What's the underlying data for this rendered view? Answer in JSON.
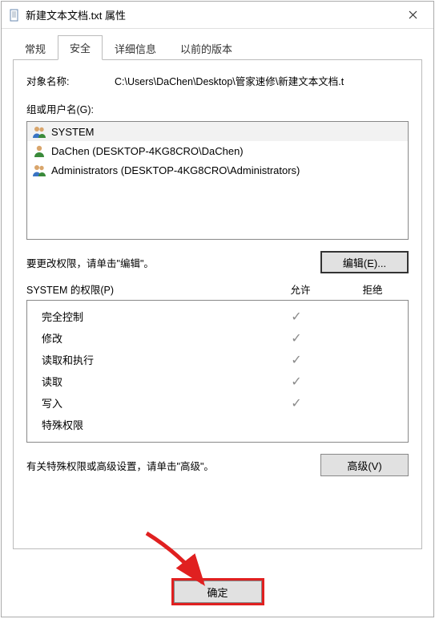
{
  "window": {
    "title": "新建文本文档.txt 属性"
  },
  "tabs": {
    "general": "常规",
    "security": "安全",
    "details": "详细信息",
    "previous": "以前的版本",
    "active": "security"
  },
  "security": {
    "objectLabel": "对象名称:",
    "objectPath": "C:\\Users\\DaChen\\Desktop\\管家速修\\新建文本文档.t",
    "groupLabel": "组或用户名(G):",
    "users": [
      {
        "name": "SYSTEM",
        "iconType": "group",
        "selected": true
      },
      {
        "name": "DaChen (DESKTOP-4KG8CRO\\DaChen)",
        "iconType": "user",
        "selected": false
      },
      {
        "name": "Administrators (DESKTOP-4KG8CRO\\Administrators)",
        "iconType": "group",
        "selected": false
      }
    ],
    "editHint": "要更改权限，请单击\"编辑\"。",
    "editButton": "编辑(E)...",
    "permHeaderFor": "SYSTEM 的权限(P)",
    "colAllow": "允许",
    "colDeny": "拒绝",
    "permissions": [
      {
        "name": "完全控制",
        "allow": true,
        "deny": false
      },
      {
        "name": "修改",
        "allow": true,
        "deny": false
      },
      {
        "name": "读取和执行",
        "allow": true,
        "deny": false
      },
      {
        "name": "读取",
        "allow": true,
        "deny": false
      },
      {
        "name": "写入",
        "allow": true,
        "deny": false
      },
      {
        "name": "特殊权限",
        "allow": false,
        "deny": false
      }
    ],
    "advancedHint": "有关特殊权限或高级设置，请单击\"高级\"。",
    "advancedButton": "高级(V)"
  },
  "buttons": {
    "ok": "确定"
  },
  "glyphs": {
    "check": "✓"
  }
}
